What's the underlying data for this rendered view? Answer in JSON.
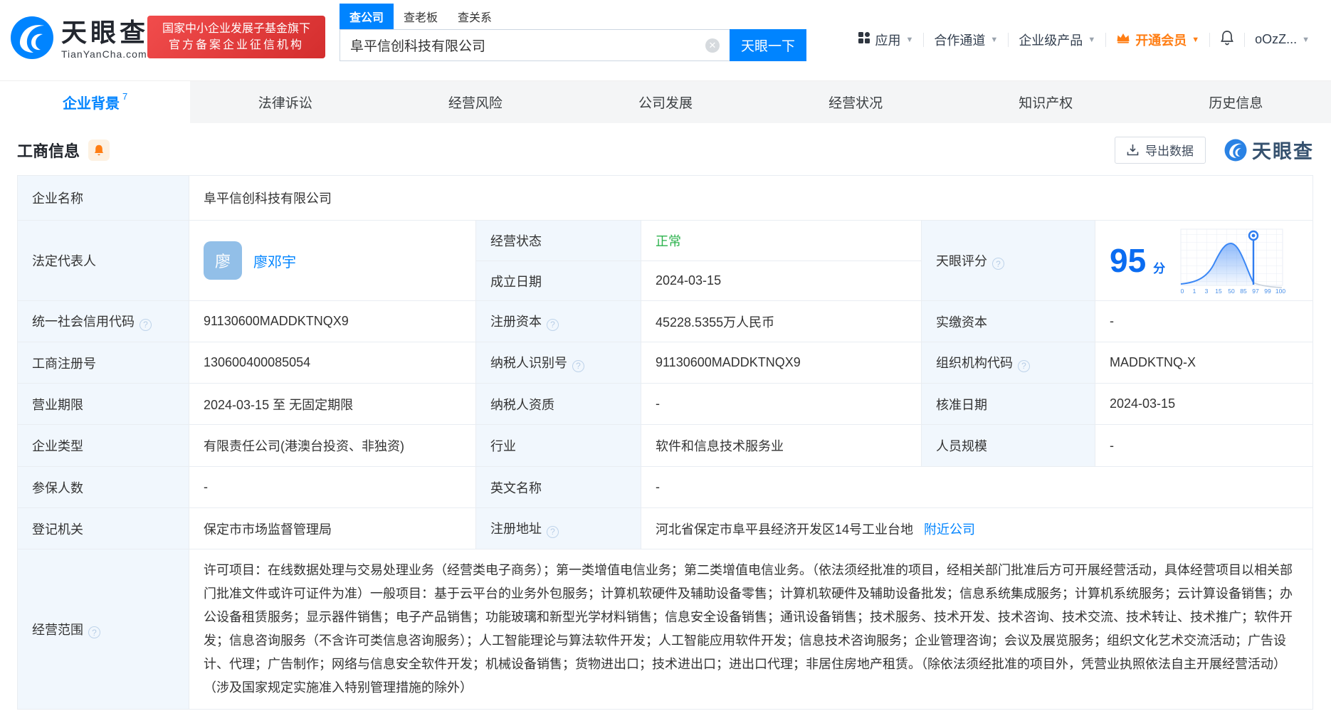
{
  "brand": {
    "name": "天眼查",
    "domain": "TianYanCha.com",
    "accent_color": "#0084ff"
  },
  "badge": {
    "line1": "国家中小企业发展子基金旗下",
    "line2": "官方备案企业征信机构"
  },
  "search": {
    "tab_company": "查公司",
    "tab_boss": "查老板",
    "tab_relation": "查关系",
    "value": "阜平信创科技有限公司",
    "button": "天眼一下"
  },
  "nav": {
    "apps": "应用",
    "coop": "合作通道",
    "enterprise": "企业级产品",
    "vip": "开通会员",
    "user": "oOzZ..."
  },
  "tabs": {
    "t0": "企业背景",
    "t0_count": "7",
    "t1": "法律诉讼",
    "t2": "经营风险",
    "t3": "公司发展",
    "t4": "经营状况",
    "t5": "知识产权",
    "t6": "历史信息"
  },
  "section": {
    "title": "工商信息",
    "export": "导出数据",
    "watermark": "天眼查"
  },
  "table": {
    "company_name_label": "企业名称",
    "company_name": "阜平信创科技有限公司",
    "legal_rep_label": "法定代表人",
    "legal_rep_avatar": "廖",
    "legal_rep_name": "廖邓宇",
    "status_label": "经营状态",
    "status_value": "正常",
    "established_label": "成立日期",
    "established_value": "2024-03-15",
    "score_label": "天眼评分",
    "score_value": "95",
    "score_unit": "分",
    "rows": [
      {
        "l1": "统一社会信用代码",
        "v1": "91130600MADDKTNQX9",
        "l2": "注册资本",
        "v2": "45228.5355万人民币",
        "l3": "实缴资本",
        "v3": "-"
      },
      {
        "l1": "工商注册号",
        "v1": "130600400085054",
        "l2": "纳税人识别号",
        "v2": "91130600MADDKTNQX9",
        "l3": "组织机构代码",
        "v3": "MADDKTNQ-X"
      },
      {
        "l1": "营业期限",
        "v1": "2024-03-15 至 无固定期限",
        "l2": "纳税人资质",
        "v2": "-",
        "l3": "核准日期",
        "v3": "2024-03-15"
      },
      {
        "l1": "企业类型",
        "v1": "有限责任公司(港澳台投资、非独资)",
        "l2": "行业",
        "v2": "软件和信息技术服务业",
        "l3": "人员规模",
        "v3": "-"
      }
    ],
    "insured_label": "参保人数",
    "insured_value": "-",
    "english_label": "英文名称",
    "english_value": "-",
    "registry_label": "登记机关",
    "registry_value": "保定市市场监督管理局",
    "address_label": "注册地址",
    "address_value": "河北省保定市阜平县经济开发区14号工业台地",
    "address_link": "附近公司",
    "scope_label": "经营范围",
    "scope_value": "许可项目：在线数据处理与交易处理业务（经营类电子商务）；第一类增值电信业务；第二类增值电信业务。（依法须经批准的项目，经相关部门批准后方可开展经营活动，具体经营项目以相关部门批准文件或许可证件为准）一般项目：基于云平台的业务外包服务；计算机软硬件及辅助设备零售；计算机软硬件及辅助设备批发；信息系统集成服务；计算机系统服务；云计算设备销售；办公设备租赁服务；显示器件销售；电子产品销售；功能玻璃和新型光学材料销售；信息安全设备销售；通讯设备销售；技术服务、技术开发、技术咨询、技术交流、技术转让、技术推广；软件开发；信息咨询服务（不含许可类信息咨询服务）；人工智能理论与算法软件开发；人工智能应用软件开发；信息技术咨询服务；企业管理咨询；会议及展览服务；组织文化艺术交流活动；广告设计、代理；广告制作；网络与信息安全软件开发；机械设备销售；货物进出口；技术进出口；进出口代理；非居住房地产租赁。（除依法须经批准的项目外，凭营业执照依法自主开展经营活动）（涉及国家规定实施准入特别管理措施的除外）"
  },
  "chart_data": {
    "type": "area",
    "title": "天眼评分分布曲线",
    "x_ticks": [
      "0",
      "1",
      "3",
      "15",
      "50",
      "85",
      "97",
      "99",
      "100"
    ],
    "marker_value": 95,
    "score": 95,
    "curve_color": "#3b87f5",
    "grid": true
  }
}
